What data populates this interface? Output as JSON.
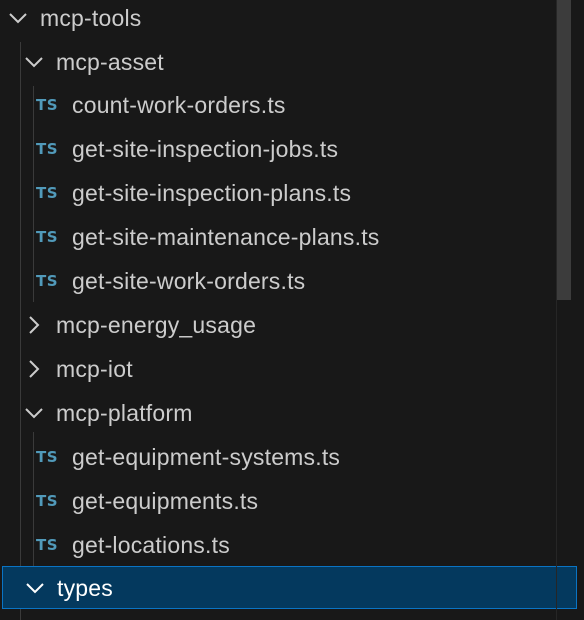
{
  "explorer": {
    "items": [
      {
        "label": "mcp-tools",
        "type": "folder",
        "state": "expanded",
        "icon": "chevron-down-icon"
      },
      {
        "label": "mcp-asset",
        "type": "folder",
        "state": "expanded",
        "icon": "chevron-down-icon"
      },
      {
        "label": "count-work-orders.ts",
        "type": "file",
        "icon_text": "TS"
      },
      {
        "label": "get-site-inspection-jobs.ts",
        "type": "file",
        "icon_text": "TS"
      },
      {
        "label": "get-site-inspection-plans.ts",
        "type": "file",
        "icon_text": "TS"
      },
      {
        "label": "get-site-maintenance-plans.ts",
        "type": "file",
        "icon_text": "TS"
      },
      {
        "label": "get-site-work-orders.ts",
        "type": "file",
        "icon_text": "TS"
      },
      {
        "label": "mcp-energy_usage",
        "type": "folder",
        "state": "collapsed",
        "icon": "chevron-right-icon"
      },
      {
        "label": "mcp-iot",
        "type": "folder",
        "state": "collapsed",
        "icon": "chevron-right-icon"
      },
      {
        "label": "mcp-platform",
        "type": "folder",
        "state": "expanded",
        "icon": "chevron-down-icon"
      },
      {
        "label": "get-equipment-systems.ts",
        "type": "file",
        "icon_text": "TS"
      },
      {
        "label": "get-equipments.ts",
        "type": "file",
        "icon_text": "TS"
      },
      {
        "label": "get-locations.ts",
        "type": "file",
        "icon_text": "TS"
      },
      {
        "label": "types",
        "type": "folder",
        "state": "expanded",
        "selected": true,
        "icon": "chevron-down-icon"
      }
    ]
  },
  "colors": {
    "background": "#181818",
    "text": "#cccccc",
    "ts_icon": "#519aba",
    "selection_bg": "#04395e",
    "selection_border": "#0a74c4",
    "scrollbar": "#3c3c3c"
  }
}
